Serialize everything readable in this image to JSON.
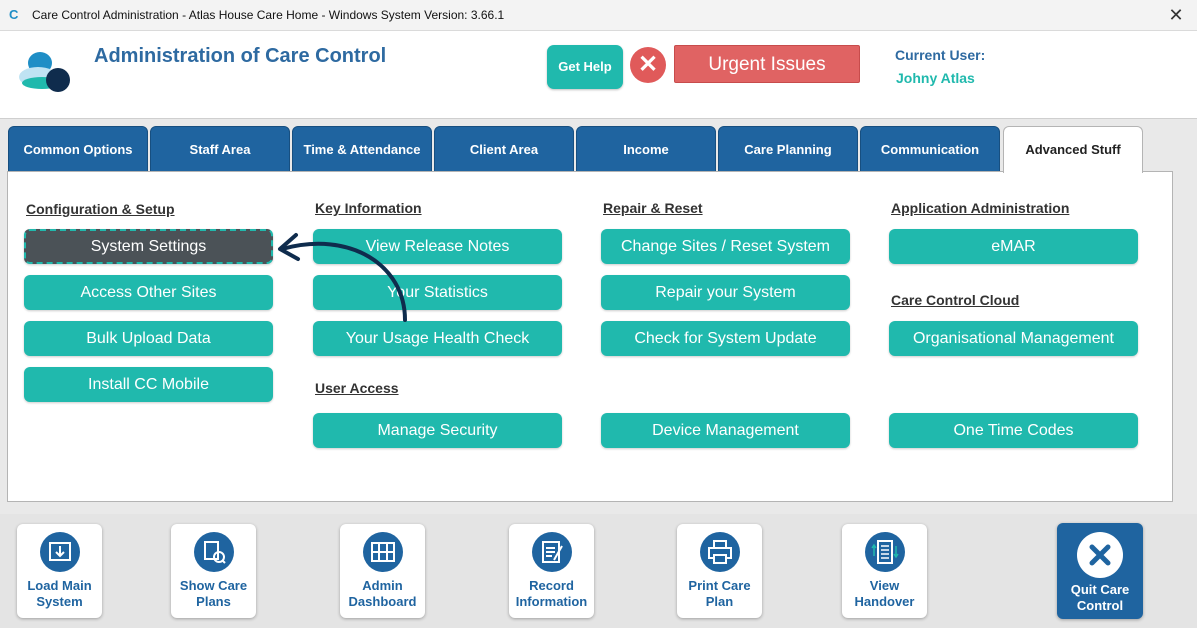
{
  "window": {
    "title": "Care Control Administration - Atlas House Care Home - Windows System Version: 3.66.1"
  },
  "header": {
    "title": "Administration of Care Control",
    "get_help": "Get Help",
    "urgent": "Urgent Issues",
    "current_user_label": "Current User:",
    "current_user": "Johny Atlas"
  },
  "tabs": [
    "Common Options",
    "Staff Area",
    "Time & Attendance",
    "Client Area",
    "Income",
    "Care Planning",
    "Communication",
    "Advanced Stuff"
  ],
  "sections": {
    "config": "Configuration & Setup",
    "key": "Key Information",
    "repair": "Repair & Reset",
    "appadmin": "Application Administration",
    "cloud": "Care Control Cloud",
    "access": "User Access"
  },
  "buttons": {
    "system_settings": "System Settings",
    "access_sites": "Access Other Sites",
    "bulk_upload": "Bulk Upload Data",
    "install_mobile": "Install CC Mobile",
    "release_notes": "View Release Notes",
    "statistics": "Your Statistics",
    "usage_health": "Your Usage Health Check",
    "manage_security": "Manage Security",
    "change_sites": "Change Sites / Reset System",
    "repair_system": "Repair your System",
    "check_update": "Check for System Update",
    "device_mgmt": "Device Management",
    "emar": "eMAR",
    "org_mgmt": "Organisational Management",
    "one_time_codes": "One Time Codes"
  },
  "bottom": {
    "load_main_1": "Load Main",
    "load_main_2": "System",
    "show_care_1": "Show Care",
    "show_care_2": "Plans",
    "admin_dash_1": "Admin",
    "admin_dash_2": "Dashboard",
    "record_info_1": "Record",
    "record_info_2": "Information",
    "print_care_1": "Print Care",
    "print_care_2": "Plan",
    "view_handover_1": "View",
    "view_handover_2": "Handover",
    "quit_1": "Quit Care",
    "quit_2": "Control"
  },
  "colors": {
    "teal": "#20b9ad",
    "navy": "#1f64a0",
    "urgent": "#e06363"
  }
}
